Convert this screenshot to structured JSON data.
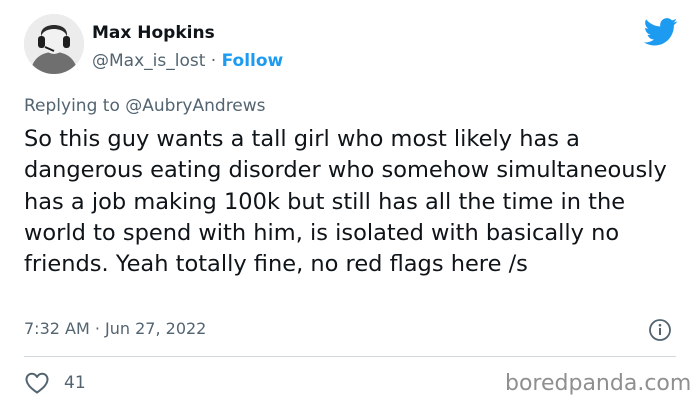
{
  "author": {
    "display_name": "Max Hopkins",
    "handle": "@Max_is_lost",
    "separator": "·",
    "follow_label": "Follow"
  },
  "reply": {
    "prefix": "Replying to",
    "mention": "@AubryAndrews"
  },
  "tweet": {
    "text": "So this guy wants a tall girl who most likely has a dangerous eating disorder who somehow simultaneously has a job making 100k but still has all the time in the world to spend with him, is isolated with basically no friends. Yeah totally fine, no red flags here /s",
    "timestamp": "7:32 AM · Jun 27, 2022"
  },
  "stats": {
    "likes": "41"
  },
  "watermark": "boredpanda.com",
  "icons": {
    "brand": "twitter-bird-icon",
    "info": "info-icon",
    "like": "heart-icon"
  },
  "colors": {
    "accent": "#1d9bf0",
    "secondary_text": "#536471",
    "primary_text": "#0f1419",
    "divider": "#cfd9de"
  }
}
